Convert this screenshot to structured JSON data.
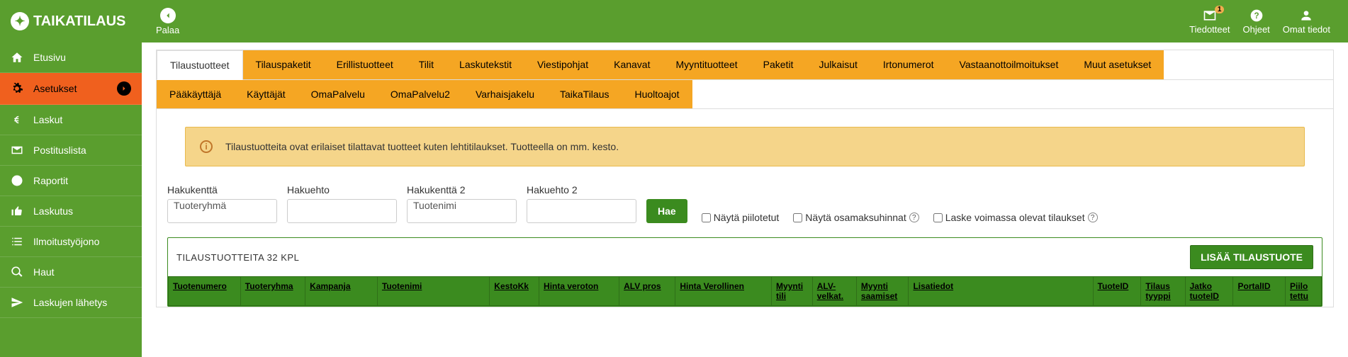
{
  "header": {
    "logo": "TAIKATILAUS",
    "back": "Palaa",
    "tiedotteet": "Tiedotteet",
    "tiedotteet_badge": "1",
    "ohjeet": "Ohjeet",
    "omat": "Omat tiedot"
  },
  "sidebar": {
    "items": [
      {
        "label": "Etusivu"
      },
      {
        "label": "Asetukset"
      },
      {
        "label": "Laskut"
      },
      {
        "label": "Postituslista"
      },
      {
        "label": "Raportit"
      },
      {
        "label": "Laskutus"
      },
      {
        "label": "Ilmoitustyöjono"
      },
      {
        "label": "Haut"
      },
      {
        "label": "Laskujen lähetys"
      }
    ]
  },
  "tabs1": [
    "Tilaustuotteet",
    "Tilauspaketit",
    "Erillistuotteet",
    "Tilit",
    "Laskutekstit",
    "Viestipohjat",
    "Kanavat",
    "Myyntituotteet",
    "Paketit",
    "Julkaisut",
    "Irtonumerot",
    "Vastaanottoilmoitukset",
    "Muut asetukset"
  ],
  "tabs2": [
    "Pääkäyttäjä",
    "Käyttäjät",
    "OmaPalvelu",
    "OmaPalvelu2",
    "Varhaisjakelu",
    "TaikaTilaus",
    "Huoltoajot"
  ],
  "info": "Tilaustuotteita ovat erilaiset tilattavat tuotteet kuten lehtitilaukset. Tuotteella on mm. kesto.",
  "search": {
    "l1": "Hakukenttä",
    "v1": "Tuoteryhmä",
    "l2": "Hakuehto",
    "v2": "",
    "l3": "Hakukenttä 2",
    "v3": "Tuotenimi",
    "l4": "Hakuehto 2",
    "v4": "",
    "btn": "Hae",
    "chk1": "Näytä piilotetut",
    "chk2": "Näytä osamaksuhinnat",
    "chk3": "Laske voimassa olevat tilaukset"
  },
  "table": {
    "title": "TILAUSTUOTTEITA 32 KPL",
    "add": "LISÄÄ TILAUSTUOTE",
    "cols": [
      "Tuotenumero",
      "Tuoteryhma",
      "Kampanja",
      "Tuotenimi",
      "KestoKk",
      "Hinta veroton",
      "ALV pros",
      "Hinta Verollinen",
      "Myynti tili",
      "ALV-velkat.",
      "Myynti saamiset",
      "Lisatiedot",
      "TuoteID",
      "Tilaus tyyppi",
      "Jatko tuoteID",
      "PortalID",
      "Piilo tettu"
    ]
  }
}
